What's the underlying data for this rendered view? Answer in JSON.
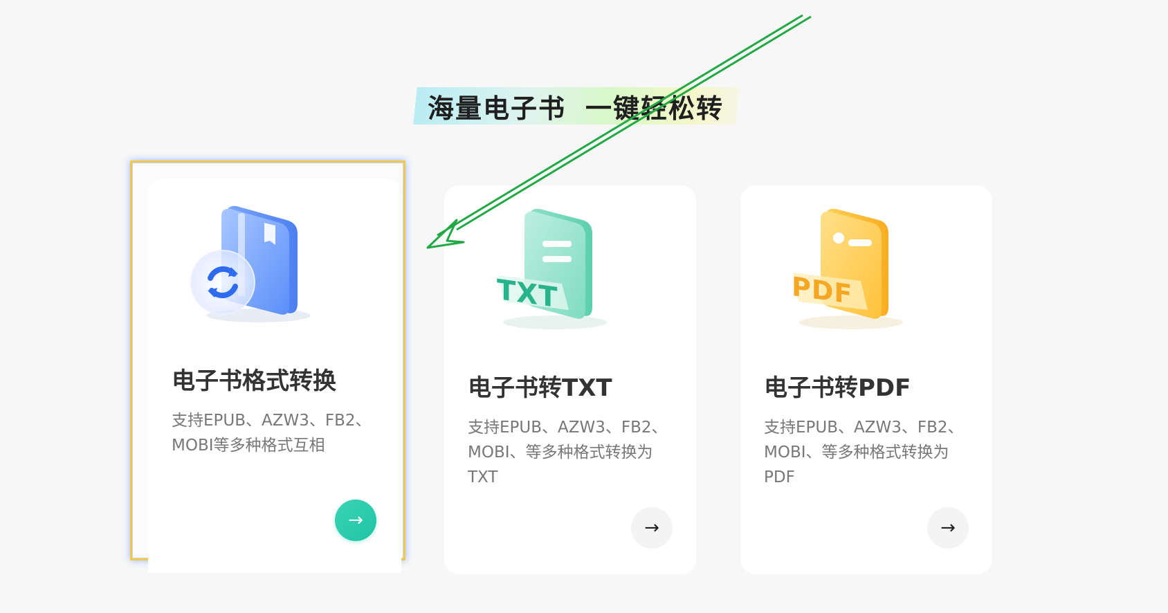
{
  "headline": {
    "part1": "海量电子书",
    "part2": "一键轻松转"
  },
  "cards": [
    {
      "title": "电子书格式转换",
      "desc": "支持EPUB、AZW3、FB2、MOBI等多种格式互相",
      "icon": "book-convert-icon",
      "button_glyph": "→",
      "selected": true
    },
    {
      "title": "电子书转TXT",
      "desc": "支持EPUB、AZW3、FB2、MOBI、等多种格式转换为TXT",
      "icon": "txt-file-icon",
      "icon_label": "TXT",
      "button_glyph": "→",
      "selected": false
    },
    {
      "title": "电子书转PDF",
      "desc": "支持EPUB、AZW3、FB2、MOBI、等多种格式转换为PDF",
      "icon": "pdf-file-icon",
      "icon_label": "PDF",
      "button_glyph": "→",
      "selected": false
    }
  ],
  "colors": {
    "accent": "#1fc3a4",
    "selection_border": "#f2c84a",
    "annotation_arrow": "#22a845",
    "book_blue": "#5b8ff9",
    "txt_green": "#3fc7a0",
    "pdf_yellow": "#ffc93c"
  }
}
